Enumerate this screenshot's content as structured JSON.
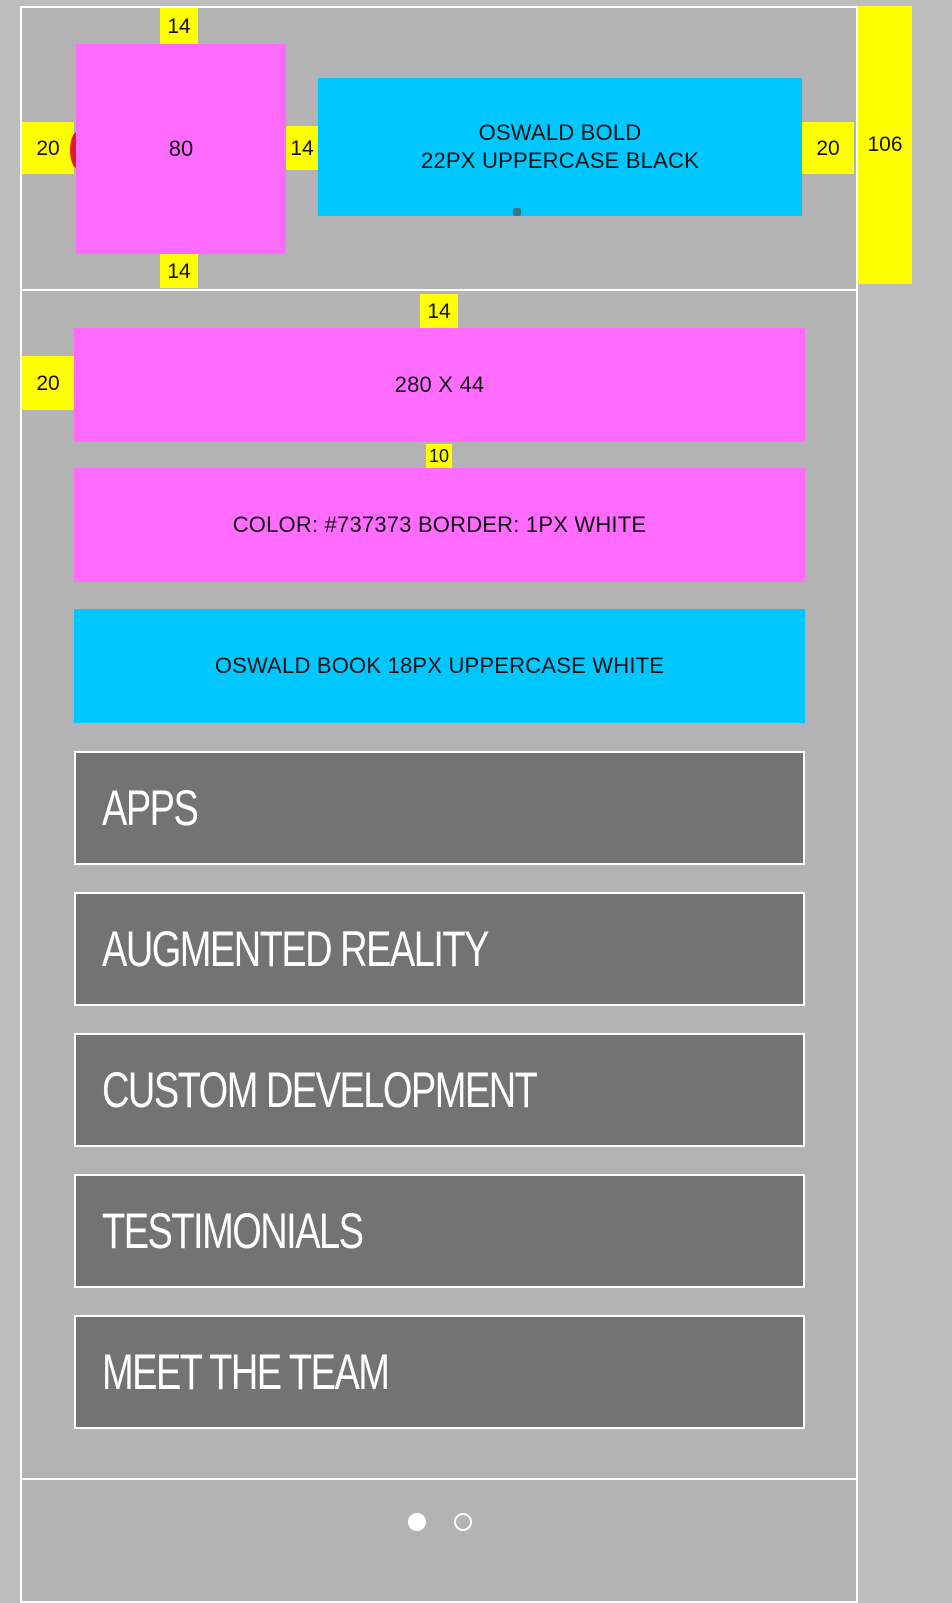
{
  "spacing": {
    "top_padding": "14",
    "bottom_padding": "14",
    "left_padding": "20",
    "gap_logo_title": "14",
    "right_padding": "20",
    "header_height": "106",
    "section_top_padding": "14",
    "section_left_padding": "20",
    "button_gap": "10"
  },
  "header": {
    "logo_size": "80",
    "title_spec": "OSWALD BOLD\n22PX UPPERCASE BLACK"
  },
  "content": {
    "box_size": "280 X 44",
    "button_style": "COLOR: #737373 BORDER: 1PX WHITE",
    "font_spec": "OSWALD BOOK 18PX UPPERCASE WHITE"
  },
  "menu": {
    "items": [
      "APPS",
      "AUGMENTED REALITY",
      "CUSTOM DEVELOPMENT",
      "TESTIMONIALS",
      "MEET THE TEAM"
    ]
  },
  "pagination": {
    "active_index": 0,
    "count": 2
  },
  "colors": {
    "background": "#bdbdbd",
    "panel": "#b3b3b3",
    "guide_yellow": "#ffff00",
    "guide_magenta": "#ff6bff",
    "guide_cyan": "#00c8ff",
    "menu_fill": "#737373",
    "white": "#ffffff",
    "red_accent": "#e01b24"
  }
}
